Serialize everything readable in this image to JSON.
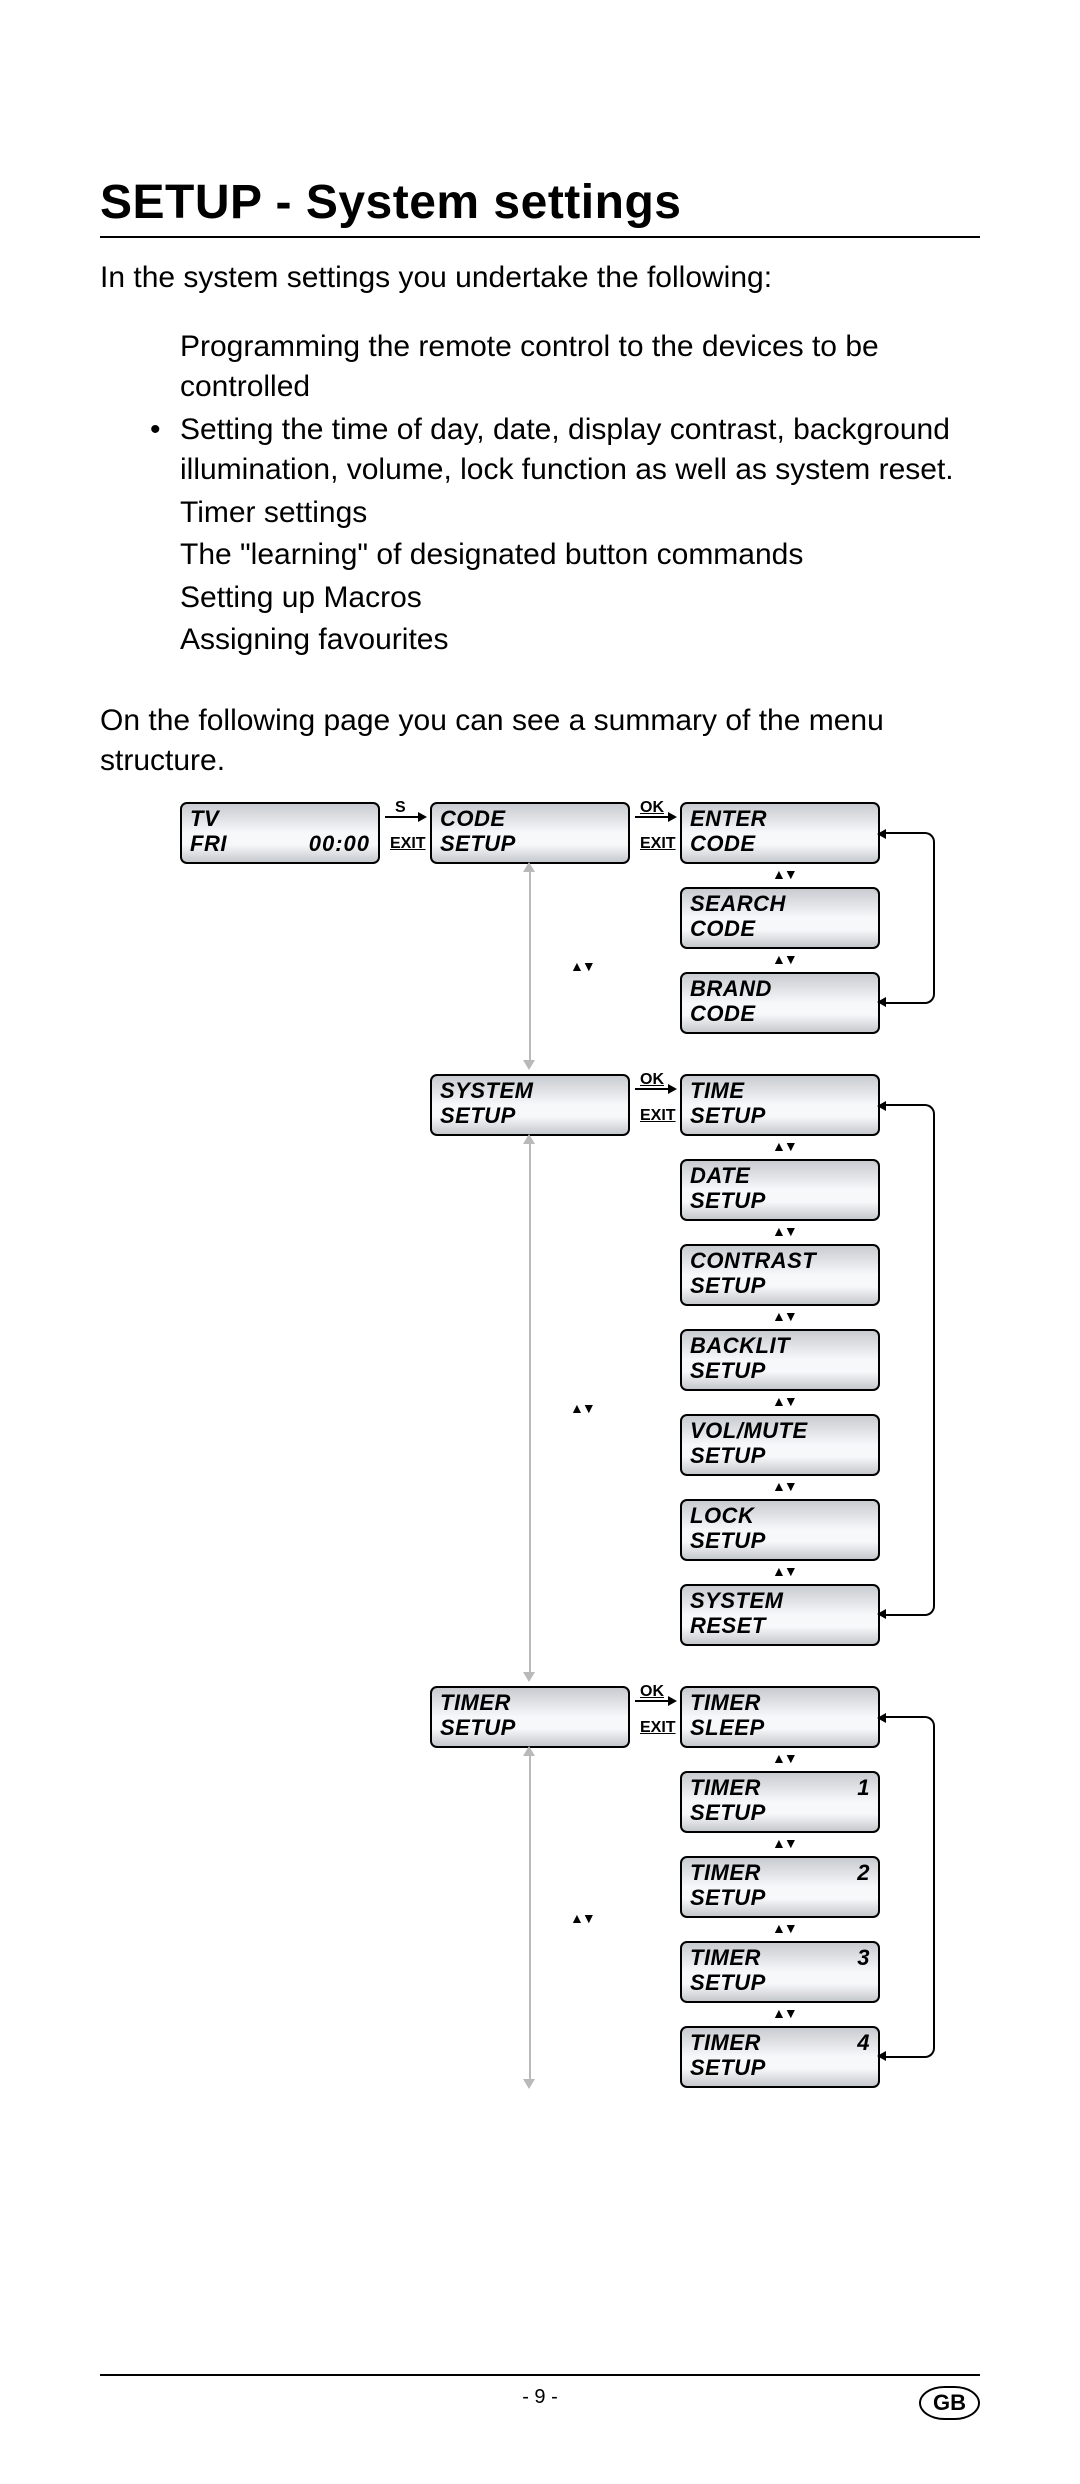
{
  "heading": "SETUP - System settings",
  "intro": "In the system settings you undertake the following:",
  "list_items": [
    {
      "text": "Programming the remote control to the devices to be controlled",
      "bulleted": false
    },
    {
      "text": "Setting the time of day, date, display contrast, background illumination, volume, lock function as well as system reset.",
      "bulleted": true
    },
    {
      "text": "Timer settings",
      "bulleted": false
    },
    {
      "text": "The \"learning\" of designated button commands",
      "bulleted": false
    },
    {
      "text": "Setting up Macros",
      "bulleted": false
    },
    {
      "text": "Assigning favourites",
      "bulleted": false
    }
  ],
  "follow": "On the following page you can see a summary of the menu structure.",
  "labels": {
    "s": "S",
    "ok": "OK",
    "exit": "EXIT",
    "updown": "▲▼"
  },
  "lcd": {
    "tv": {
      "l1": "TV",
      "l2a": "FRI",
      "l2b": "00:00"
    },
    "code_setup": {
      "l1": "CODE",
      "l2": "SETUP"
    },
    "enter_code": {
      "l1": "ENTER",
      "l2": "CODE"
    },
    "search_code": {
      "l1": "SEARCH",
      "l2": "CODE"
    },
    "brand_code": {
      "l1": "BRAND",
      "l2": "CODE"
    },
    "system_setup": {
      "l1": "SYSTEM",
      "l2": "SETUP"
    },
    "time_setup": {
      "l1": "TIME",
      "l2": "SETUP"
    },
    "date_setup": {
      "l1": "DATE",
      "l2": "SETUP"
    },
    "contrast_setup": {
      "l1": "CONTRAST",
      "l2": "SETUP"
    },
    "backlit_setup": {
      "l1": "BACKLIT",
      "l2": "SETUP"
    },
    "volmute_setup": {
      "l1": "VOL/MUTE",
      "l2": "SETUP"
    },
    "lock_setup": {
      "l1": "LOCK",
      "l2": "SETUP"
    },
    "system_reset": {
      "l1": "SYSTEM",
      "l2": "RESET"
    },
    "timer_setup": {
      "l1": "TIMER",
      "l2": "SETUP"
    },
    "timer_sleep": {
      "l1": "TIMER",
      "l2": "SLEEP"
    },
    "timer1": {
      "l1": "TIMER",
      "r1": "1",
      "l2": "SETUP"
    },
    "timer2": {
      "l1": "TIMER",
      "r1": "2",
      "l2": "SETUP"
    },
    "timer3": {
      "l1": "TIMER",
      "r1": "3",
      "l2": "SETUP"
    },
    "timer4": {
      "l1": "TIMER",
      "r1": "4",
      "l2": "SETUP"
    }
  },
  "footer": {
    "page": "- 9 -",
    "region": "GB"
  }
}
